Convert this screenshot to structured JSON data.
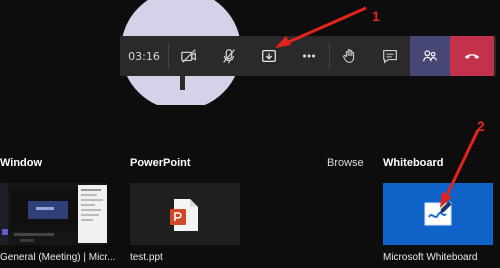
{
  "call_bar": {
    "timer": "03:16",
    "buttons": [
      {
        "name": "camera-off",
        "icon": "camera-off-icon"
      },
      {
        "name": "mic-off",
        "icon": "mic-off-icon"
      },
      {
        "name": "share",
        "icon": "share-tray-icon"
      },
      {
        "name": "more",
        "icon": "more-icon"
      },
      {
        "name": "raise-hand",
        "icon": "raise-hand-icon"
      },
      {
        "name": "chat",
        "icon": "chat-icon"
      },
      {
        "name": "participants",
        "icon": "people-icon"
      },
      {
        "name": "leave",
        "icon": "hang-up-icon"
      }
    ]
  },
  "annotations": {
    "arrow1": "1",
    "arrow2": "2"
  },
  "share_tray": {
    "sections": {
      "window": "Window",
      "powerpoint": "PowerPoint",
      "browse": "Browse",
      "whiteboard": "Whiteboard"
    },
    "items": {
      "window_caption": "General (Meeting) | Micr...",
      "ppt_caption": "test.ppt",
      "wb_caption": "Microsoft Whiteboard"
    }
  },
  "colors": {
    "background": "#0b0b0b",
    "call_bar": "#2a2a2a",
    "participants_button": "#464775",
    "leave_button": "#c4314b",
    "whiteboard_tile": "#0f62c8",
    "annotation_red": "#e3241c"
  }
}
